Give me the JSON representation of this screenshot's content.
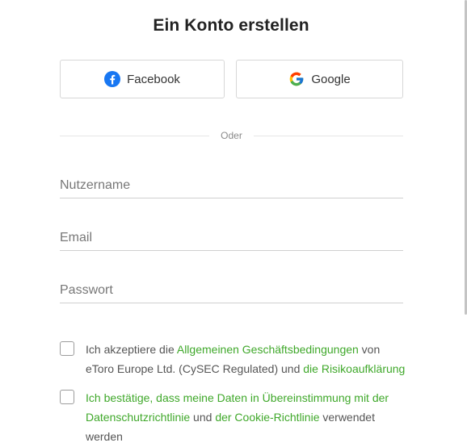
{
  "title": "Ein Konto erstellen",
  "social": {
    "facebook_label": "Facebook",
    "google_label": "Google"
  },
  "divider_text": "Oder",
  "fields": {
    "username_placeholder": "Nutzername",
    "email_placeholder": "Email",
    "password_placeholder": "Passwort"
  },
  "terms": {
    "pre": "Ich akzeptiere die ",
    "link1": "Allgemeinen Geschäftsbedingungen",
    "mid": " von eToro Europe Ltd. (CySEC Regulated) und ",
    "link2": "die Risikoaufklärung"
  },
  "privacy": {
    "link1": "Ich bestätige, dass meine Daten in Übereinstimmung mit der Datenschutzrichtlinie",
    "mid": " und ",
    "link2": "der Cookie-Richtlinie",
    "post": " verwendet werden"
  },
  "colors": {
    "facebook_blue": "#1877f2",
    "link_green": "#3fa82a"
  },
  "icons": {
    "facebook": "facebook-icon",
    "google": "google-icon"
  }
}
